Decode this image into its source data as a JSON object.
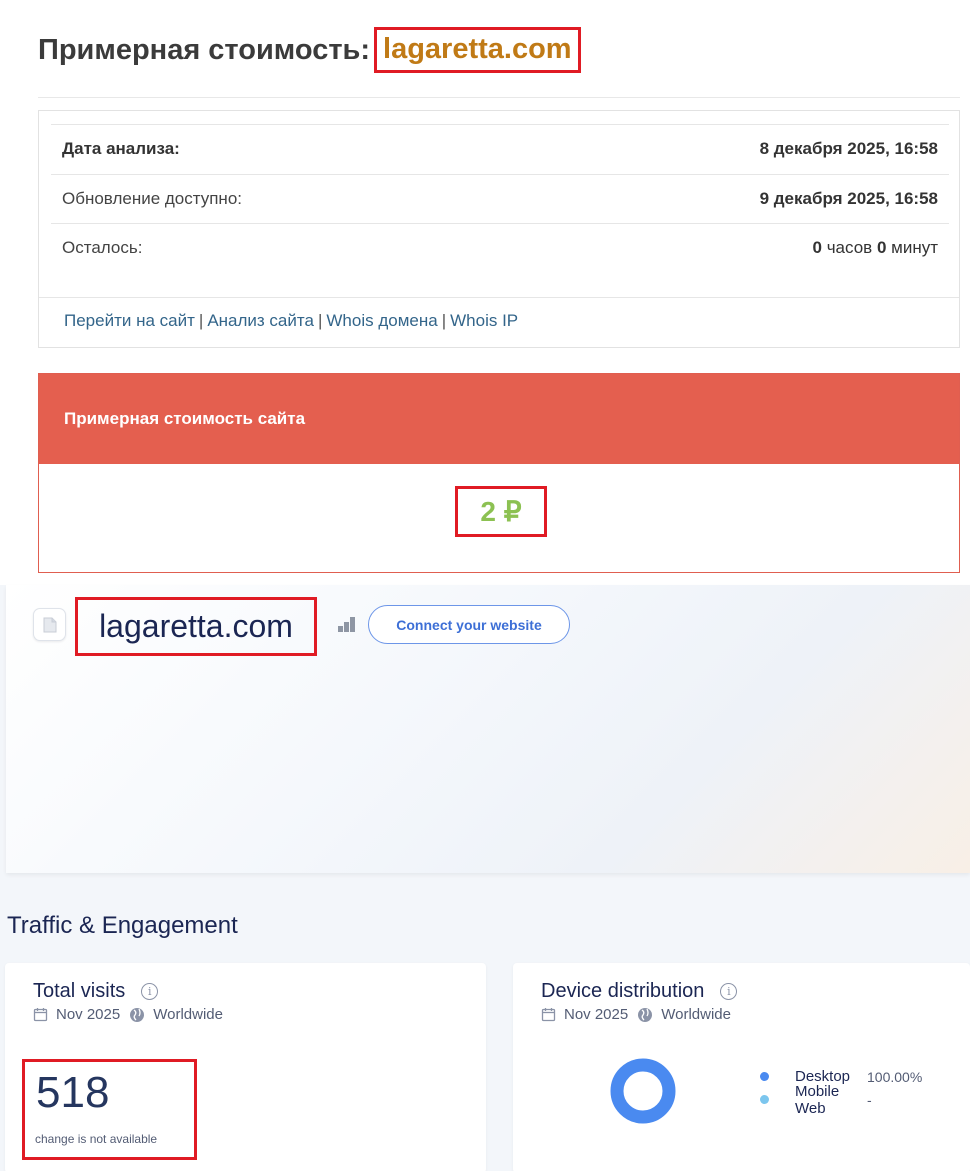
{
  "header": {
    "title": "Примерная стоимость:",
    "domain": "lagaretta.com"
  },
  "info": {
    "rows": [
      {
        "label": "Дата анализа:",
        "value": "8 декабря 2025, 16:58"
      },
      {
        "label": "Обновление доступно:",
        "value": "9 декабря 2025, 16:58"
      }
    ],
    "remaining": {
      "label": "Осталось:",
      "hours": "0",
      "hours_unit": "часов",
      "minutes": "0",
      "minutes_unit": "минут"
    },
    "links": [
      "Перейти на сайт",
      "Анализ сайта",
      "Whois домена",
      "Whois IP"
    ],
    "separator": "|"
  },
  "cost": {
    "title": "Примерная стоимость сайта",
    "value": "2 ₽"
  },
  "site": {
    "name": "lagaretta.com",
    "connect_label": "Connect your website"
  },
  "traffic": {
    "section_title": "Traffic & Engagement",
    "total_visits": {
      "title": "Total visits",
      "period": "Nov 2025",
      "region": "Worldwide",
      "value": "518",
      "change": "change is not available"
    },
    "device": {
      "title": "Device distribution",
      "period": "Nov 2025",
      "region": "Worldwide",
      "items": [
        {
          "name": "Desktop",
          "value": "100.00%",
          "color": "#4a8af0",
          "share": 1.0
        },
        {
          "name": "Mobile Web",
          "value": "-",
          "color": "#7cc6ee",
          "share": 0.0
        }
      ]
    }
  },
  "colors": {
    "accent_red": "#e45f4f",
    "highlight_box": "#e01b24",
    "domain_orange": "#c07a16",
    "price_green": "#8cc152",
    "link_blue": "#33658a"
  }
}
